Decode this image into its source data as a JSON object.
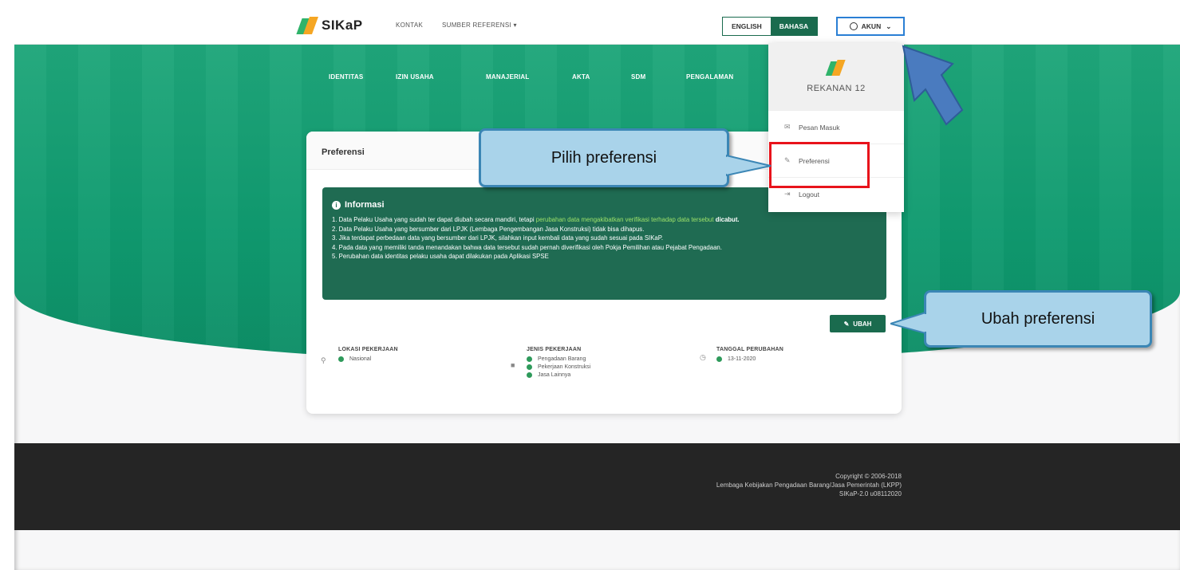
{
  "navbar": {
    "brand": "SIKaP",
    "links": [
      "KONTAK",
      "SUMBER REFERENSI ▾"
    ],
    "lang_en": "ENGLISH",
    "lang_id": "BAHASA",
    "account": "AKUN"
  },
  "tabs": [
    "IDENTITAS",
    "IZIN USAHA",
    "MANAJERIAL",
    "AKTA",
    "SDM",
    "PENGALAMAN"
  ],
  "card": {
    "title": "Preferensi",
    "info_title": "Informasi",
    "info_lines": [
      {
        "pre": "1. Data Pelaku Usaha yang sudah ter dapat diubah secara mandiri, tetapi ",
        "hl": "perubahan data mengakibatkan verifikasi terhadap data tersebut",
        "post": " dicabut."
      },
      {
        "pre": "2. Data Pelaku Usaha yang bersumber dari LPJK (Lembaga Pengembangan Jasa Konstruksi) tidak bisa dihapus.",
        "hl": "",
        "post": ""
      },
      {
        "pre": "3. Jika terdapat perbedaan data yang bersumber dari LPJK, silahkan input kembali data yang sudah sesuai pada SIKaP.",
        "hl": "",
        "post": ""
      },
      {
        "pre": "4. Pada data yang memiliki tanda menandakan bahwa data tersebut sudah pernah diverifikasi oleh Pokja Pemilihan atau Pejabat Pengadaan.",
        "hl": "",
        "post": ""
      },
      {
        "pre": "5. Perubahan data identitas pelaku usaha dapat dilakukan pada Aplikasi SPSE",
        "hl": "",
        "post": ""
      }
    ],
    "edit_button": "UBAH",
    "lokasi": {
      "label": "LOKASI PEKERJAAN",
      "values": [
        "Nasional"
      ]
    },
    "jenis": {
      "label": "JENIS PEKERJAAN",
      "values": [
        "Pengadaan Barang",
        "Pekerjaan Konstruksi",
        "Jasa Lainnya"
      ]
    },
    "tanggal": {
      "label": "TANGGAL PERUBAHAN",
      "values": [
        "13-11-2020"
      ]
    }
  },
  "dropdown": {
    "user": "REKANAN 12",
    "items": [
      "Pesan Masuk",
      "Preferensi",
      "Logout"
    ]
  },
  "callouts": {
    "pilih": "Pilih preferensi",
    "ubah": "Ubah preferensi"
  },
  "footer": {
    "line1": "Copyright © 2006-2018",
    "line2": "Lembaga Kebijakan Pengadaan Barang/Jasa Pemerintah (LKPP)",
    "line3": "SIKaP-2.0 u08112020"
  },
  "colors": {
    "primary": "#1a6b4e",
    "accent_green": "#1fa67a",
    "callout": "#a9d3ea",
    "highlight": "#e8131b"
  }
}
